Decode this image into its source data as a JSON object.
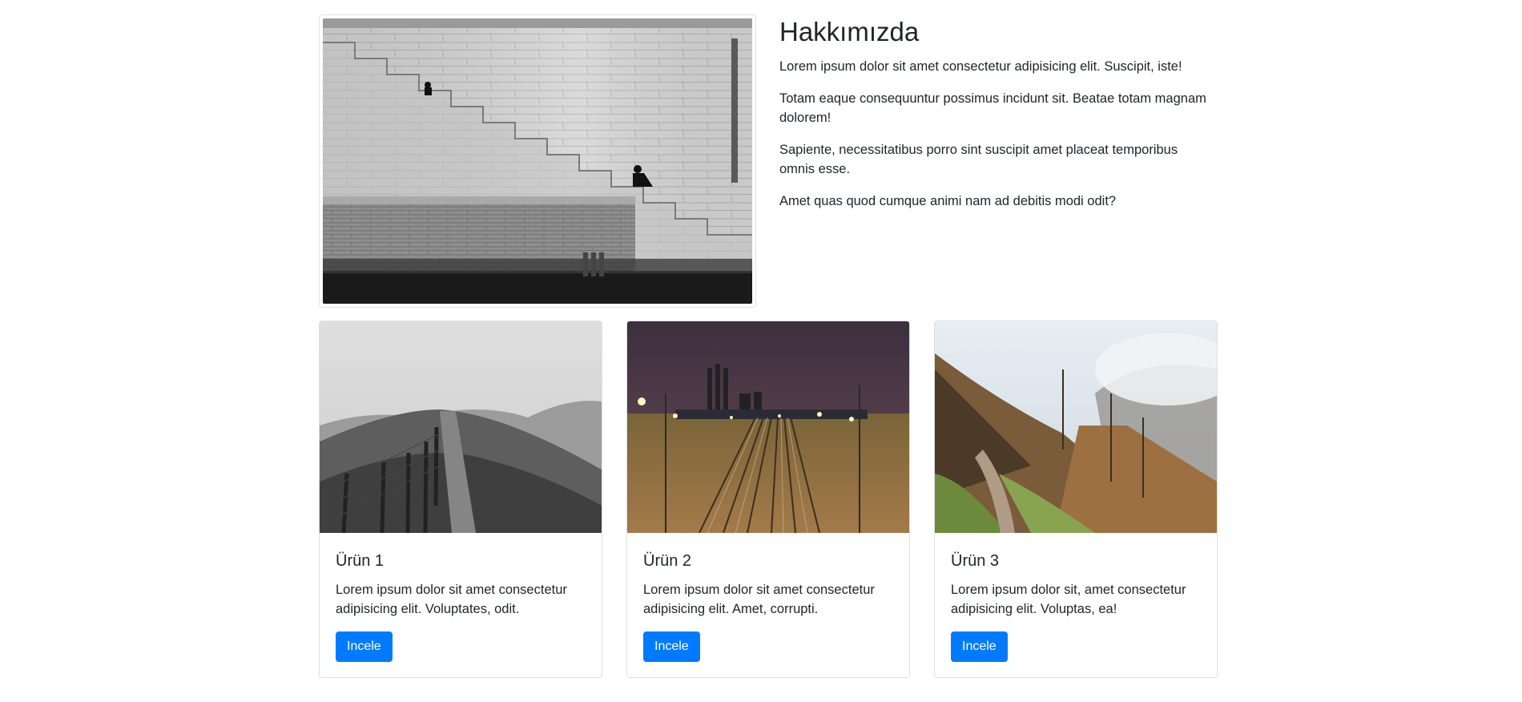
{
  "about": {
    "title": "Hakkımızda",
    "image_alt": "black-and-white photo of stone steps along a riverside wall",
    "paragraphs": [
      "Lorem ipsum dolor sit amet consectetur adipisicing elit. Suscipit, iste!",
      "Totam eaque consequuntur possimus incidunt sit. Beatae totam magnam dolorem!",
      "Sapiente, necessitatibus porro sint suscipit amet placeat temporibus omnis esse.",
      "Amet quas quod cumque animi nam ad debitis modi odit?"
    ]
  },
  "products": [
    {
      "title": "Ürün 1",
      "text": "Lorem ipsum dolor sit amet consectetur adipisicing elit. Voluptates, odit.",
      "button": "Incele"
    },
    {
      "title": "Ürün 2",
      "text": "Lorem ipsum dolor sit amet consectetur adipisicing elit. Amet, corrupti.",
      "button": "Incele"
    },
    {
      "title": "Ürün 3",
      "text": "Lorem ipsum dolor sit, amet consectetur adipisicing elit. Voluptas, ea!",
      "button": "Incele"
    }
  ],
  "colors": {
    "primary": "#007bff",
    "text": "#212529",
    "border": "#dee2e6"
  }
}
